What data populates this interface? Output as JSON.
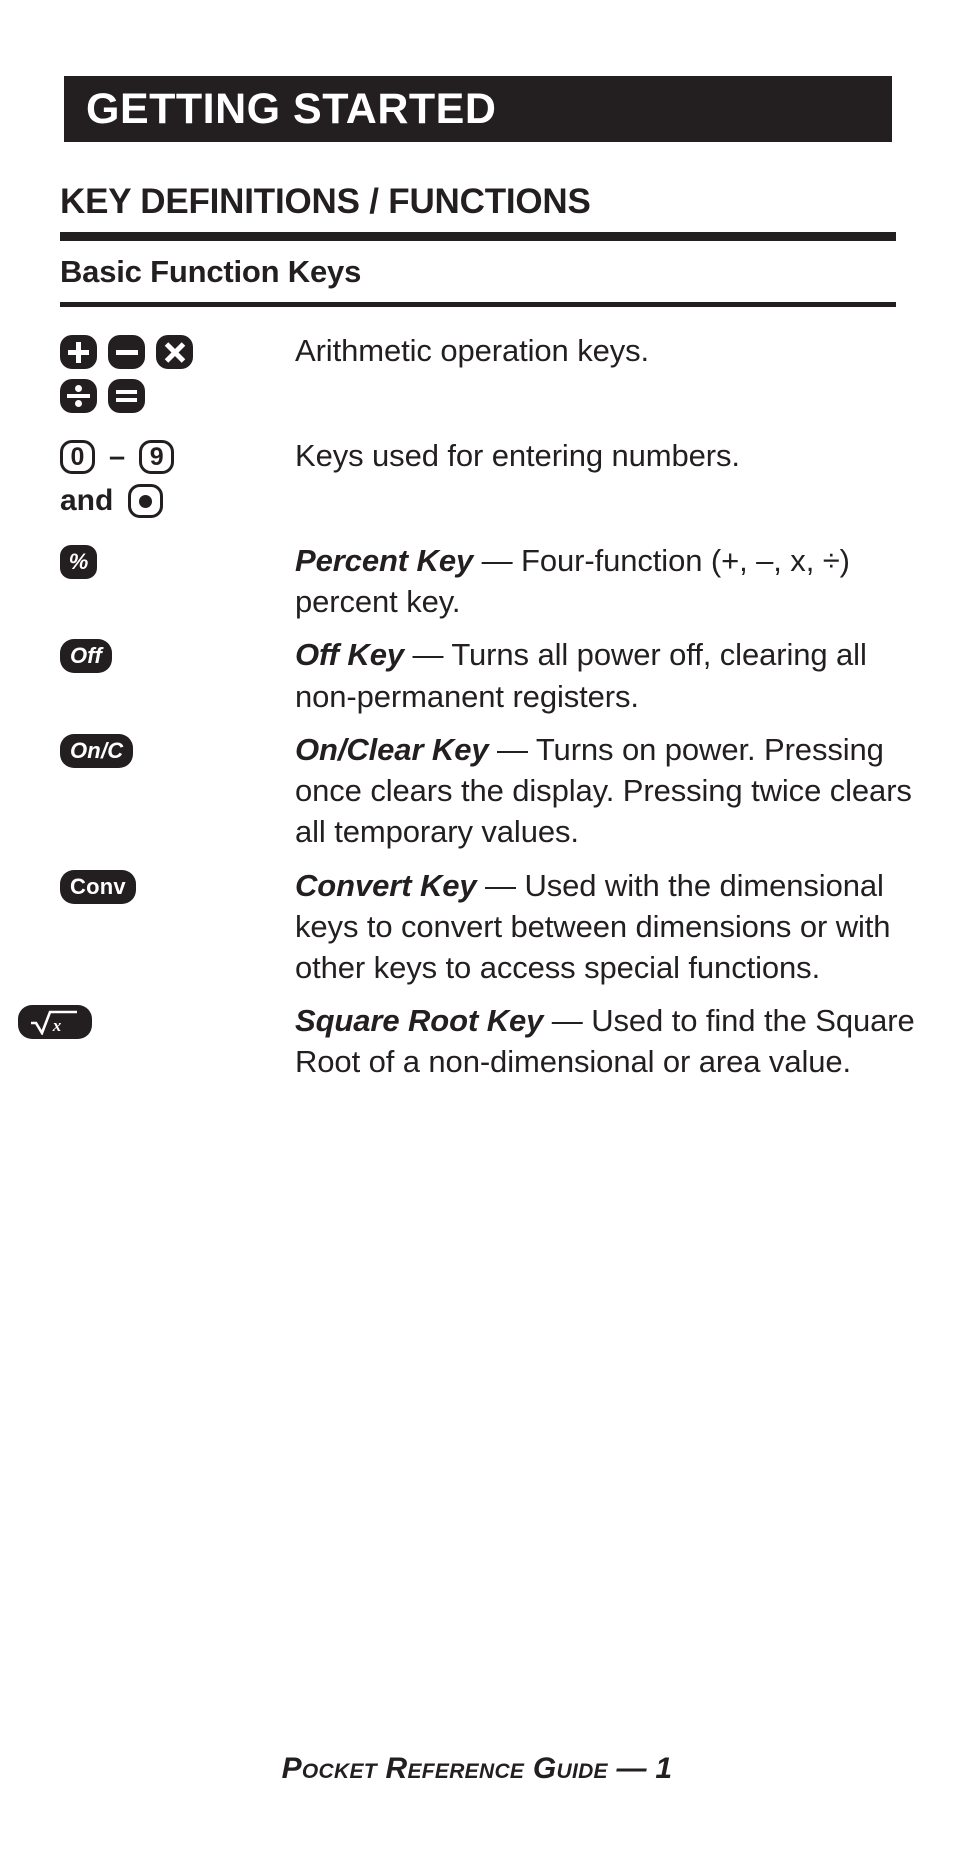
{
  "banner": {
    "title": "GETTING STARTED"
  },
  "section": {
    "heading": "KEY DEFINITIONS / FUNCTIONS",
    "subheading": "Basic Function Keys"
  },
  "rows": [
    {
      "id": "arithmetic",
      "keys": [
        "plus-key",
        "minus-key",
        "multiply-key",
        "divide-key",
        "equals-key"
      ],
      "name": "",
      "text": "Arithmetic operation keys."
    },
    {
      "id": "numbers",
      "keys": [
        "zero-key",
        "nine-key",
        "decimal-point-key"
      ],
      "key_labels": {
        "zero": "0",
        "nine": "9",
        "dash": "–",
        "and": "and"
      },
      "name": "",
      "text": "Keys used for entering numbers."
    },
    {
      "id": "percent",
      "keys": [
        "percent-key"
      ],
      "key_labels": {
        "percent": "%"
      },
      "name": "Percent Key",
      "text": " — Four-function (+, –, x, ÷) percent key."
    },
    {
      "id": "off",
      "keys": [
        "off-key"
      ],
      "key_labels": {
        "off": "Off"
      },
      "name": "Off Key",
      "text": " — Turns all power off, clearing all non-permanent registers."
    },
    {
      "id": "on-clear",
      "keys": [
        "on-clear-key"
      ],
      "key_labels": {
        "onc": "On/C"
      },
      "name": "On/Clear Key",
      "text": " — Turns on power. Pressing once clears the display. Pressing twice clears all temporary values."
    },
    {
      "id": "convert",
      "keys": [
        "convert-key"
      ],
      "key_labels": {
        "conv": "Conv"
      },
      "name": "Convert Key",
      "text": " — Used with the dimensional keys to convert between dimensions or with other keys to access special functions."
    },
    {
      "id": "square-root",
      "keys": [
        "square-root-key"
      ],
      "key_labels": {
        "sqrt": "√x"
      },
      "name": "Square Root Key",
      "text": " — Used to find the Square Root of a non-dimensional or area value."
    }
  ],
  "footer": {
    "text": "Pocket Reference Guide — 1"
  },
  "colors": {
    "ink": "#231f20",
    "paper": "#ffffff"
  }
}
